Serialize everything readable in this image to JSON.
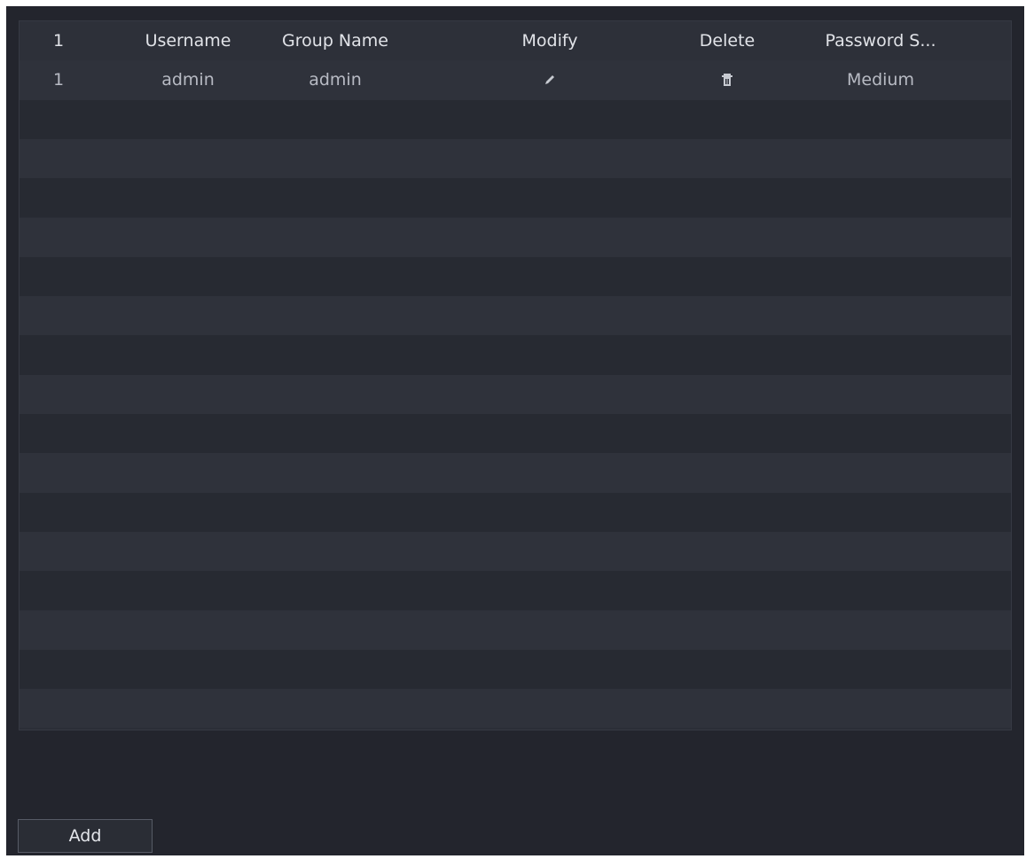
{
  "table": {
    "columns": [
      "1",
      "Username",
      "Group Name",
      "Modify",
      "Delete",
      "Password S..."
    ],
    "rows": [
      {
        "index": "1",
        "username": "admin",
        "group_name": "admin",
        "modify_icon": "pencil-icon",
        "delete_icon": "trash-icon",
        "password_strength": "Medium"
      }
    ]
  },
  "footer": {
    "add_label": "Add"
  },
  "colors": {
    "background": "#23252d",
    "table_row_light": "#2f323b",
    "table_row_dark": "#272a32",
    "text": "#d4d6dd"
  }
}
